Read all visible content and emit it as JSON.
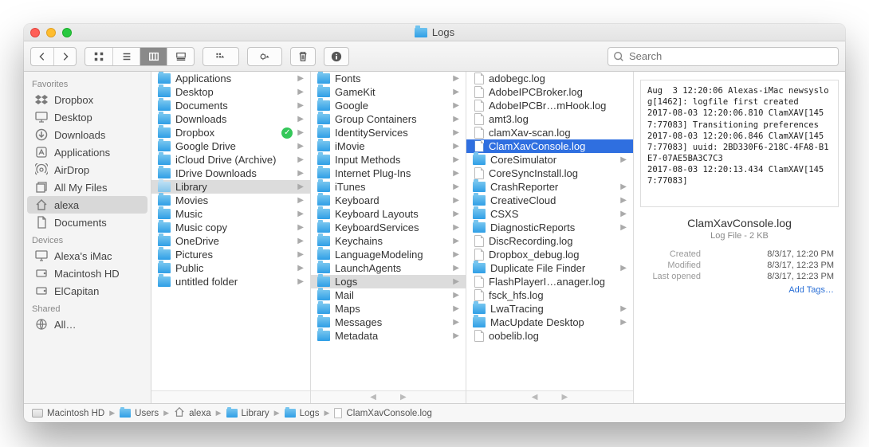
{
  "title": "Logs",
  "search": {
    "placeholder": "Search"
  },
  "sidebar": {
    "sections": [
      {
        "header": "Favorites",
        "items": [
          {
            "name": "dropbox",
            "label": "Dropbox",
            "icon": "dropbox"
          },
          {
            "name": "desktop",
            "label": "Desktop",
            "icon": "desktop"
          },
          {
            "name": "downloads",
            "label": "Downloads",
            "icon": "downloads"
          },
          {
            "name": "applications",
            "label": "Applications",
            "icon": "apps"
          },
          {
            "name": "airdrop",
            "label": "AirDrop",
            "icon": "airdrop"
          },
          {
            "name": "allmyfiles",
            "label": "All My Files",
            "icon": "allfiles"
          },
          {
            "name": "alexa",
            "label": "alexa",
            "icon": "home",
            "selected": true
          },
          {
            "name": "documents",
            "label": "Documents",
            "icon": "documents"
          }
        ]
      },
      {
        "header": "Devices",
        "items": [
          {
            "name": "alexas-imac",
            "label": "Alexa's iMac",
            "icon": "imac"
          },
          {
            "name": "macintosh-hd",
            "label": "Macintosh HD",
            "icon": "disk"
          },
          {
            "name": "elcapitan",
            "label": "ElCapitan",
            "icon": "disk"
          }
        ]
      },
      {
        "header": "Shared",
        "items": [
          {
            "name": "all-shared",
            "label": "All…",
            "icon": "globe"
          }
        ]
      }
    ]
  },
  "columns": [
    {
      "name": "home",
      "items": [
        {
          "label": "Applications",
          "type": "folder",
          "arrow": true
        },
        {
          "label": "Desktop",
          "type": "folder",
          "arrow": true
        },
        {
          "label": "Documents",
          "type": "folder",
          "arrow": true
        },
        {
          "label": "Downloads",
          "type": "folder",
          "arrow": true
        },
        {
          "label": "Dropbox",
          "type": "folder",
          "arrow": true,
          "badge": true
        },
        {
          "label": "Google Drive",
          "type": "folder",
          "arrow": true
        },
        {
          "label": "iCloud Drive (Archive)",
          "type": "folder",
          "arrow": true
        },
        {
          "label": "IDrive Downloads",
          "type": "folder",
          "arrow": true
        },
        {
          "label": "Library",
          "type": "folder-lt",
          "arrow": true,
          "sel": "path"
        },
        {
          "label": "Movies",
          "type": "folder",
          "arrow": true
        },
        {
          "label": "Music",
          "type": "folder",
          "arrow": true
        },
        {
          "label": "Music copy",
          "type": "folder",
          "arrow": true
        },
        {
          "label": "OneDrive",
          "type": "folder",
          "arrow": true
        },
        {
          "label": "Pictures",
          "type": "folder",
          "arrow": true
        },
        {
          "label": "Public",
          "type": "folder",
          "arrow": true
        },
        {
          "label": "untitled folder",
          "type": "folder",
          "arrow": true
        }
      ]
    },
    {
      "name": "library",
      "items": [
        {
          "label": "Fonts",
          "type": "folder",
          "arrow": true
        },
        {
          "label": "GameKit",
          "type": "folder",
          "arrow": true
        },
        {
          "label": "Google",
          "type": "folder",
          "arrow": true
        },
        {
          "label": "Group Containers",
          "type": "folder",
          "arrow": true
        },
        {
          "label": "IdentityServices",
          "type": "folder",
          "arrow": true
        },
        {
          "label": "iMovie",
          "type": "folder",
          "arrow": true
        },
        {
          "label": "Input Methods",
          "type": "folder",
          "arrow": true
        },
        {
          "label": "Internet Plug-Ins",
          "type": "folder",
          "arrow": true
        },
        {
          "label": "iTunes",
          "type": "folder",
          "arrow": true
        },
        {
          "label": "Keyboard",
          "type": "folder",
          "arrow": true
        },
        {
          "label": "Keyboard Layouts",
          "type": "folder",
          "arrow": true
        },
        {
          "label": "KeyboardServices",
          "type": "folder",
          "arrow": true
        },
        {
          "label": "Keychains",
          "type": "folder",
          "arrow": true
        },
        {
          "label": "LanguageModeling",
          "type": "folder",
          "arrow": true
        },
        {
          "label": "LaunchAgents",
          "type": "folder",
          "arrow": true
        },
        {
          "label": "Logs",
          "type": "folder",
          "arrow": true,
          "sel": "path"
        },
        {
          "label": "Mail",
          "type": "folder",
          "arrow": true
        },
        {
          "label": "Maps",
          "type": "folder",
          "arrow": true
        },
        {
          "label": "Messages",
          "type": "folder",
          "arrow": true
        },
        {
          "label": "Metadata",
          "type": "folder",
          "arrow": true
        }
      ]
    },
    {
      "name": "logs",
      "items": [
        {
          "label": "adobegc.log",
          "type": "file"
        },
        {
          "label": "AdobeIPCBroker.log",
          "type": "file"
        },
        {
          "label": "AdobeIPCBr…mHook.log",
          "type": "file"
        },
        {
          "label": "amt3.log",
          "type": "file"
        },
        {
          "label": "clamXav-scan.log",
          "type": "file"
        },
        {
          "label": "ClamXavConsole.log",
          "type": "file",
          "sel": "active"
        },
        {
          "label": "CoreSimulator",
          "type": "folder",
          "arrow": true
        },
        {
          "label": "CoreSyncInstall.log",
          "type": "file"
        },
        {
          "label": "CrashReporter",
          "type": "folder",
          "arrow": true
        },
        {
          "label": "CreativeCloud",
          "type": "folder",
          "arrow": true
        },
        {
          "label": "CSXS",
          "type": "folder",
          "arrow": true
        },
        {
          "label": "DiagnosticReports",
          "type": "folder",
          "arrow": true
        },
        {
          "label": "DiscRecording.log",
          "type": "file"
        },
        {
          "label": "Dropbox_debug.log",
          "type": "file"
        },
        {
          "label": "Duplicate File Finder",
          "type": "folder",
          "arrow": true
        },
        {
          "label": "FlashPlayerI…anager.log",
          "type": "file"
        },
        {
          "label": "fsck_hfs.log",
          "type": "file"
        },
        {
          "label": "LwaTracing",
          "type": "folder",
          "arrow": true
        },
        {
          "label": "MacUpdate Desktop",
          "type": "folder",
          "arrow": true
        },
        {
          "label": "oobelib.log",
          "type": "file"
        }
      ]
    }
  ],
  "preview": {
    "text": "Aug  3 12:20:06 Alexas-iMac newsyslog[1462]: logfile first created\n2017-08-03 12:20:06.810 ClamXAV[1457:77083] Transitioning preferences\n2017-08-03 12:20:06.846 ClamXAV[1457:77083] uuid: 2BD330F6-218C-4FA8-B1E7-07AE5BA3C7C3\n2017-08-03 12:20:13.434 ClamXAV[1457:77083]",
    "name": "ClamXavConsole.log",
    "kind": "Log File - 2 KB",
    "meta": [
      {
        "k": "Created",
        "v": "8/3/17, 12:20 PM"
      },
      {
        "k": "Modified",
        "v": "8/3/17, 12:23 PM"
      },
      {
        "k": "Last opened",
        "v": "8/3/17, 12:23 PM"
      }
    ],
    "add_tags": "Add Tags…"
  },
  "pathbar": [
    {
      "label": "Macintosh HD",
      "icon": "hd"
    },
    {
      "label": "Users",
      "icon": "folder"
    },
    {
      "label": "alexa",
      "icon": "home"
    },
    {
      "label": "Library",
      "icon": "folder"
    },
    {
      "label": "Logs",
      "icon": "folder"
    },
    {
      "label": "ClamXavConsole.log",
      "icon": "file"
    }
  ]
}
